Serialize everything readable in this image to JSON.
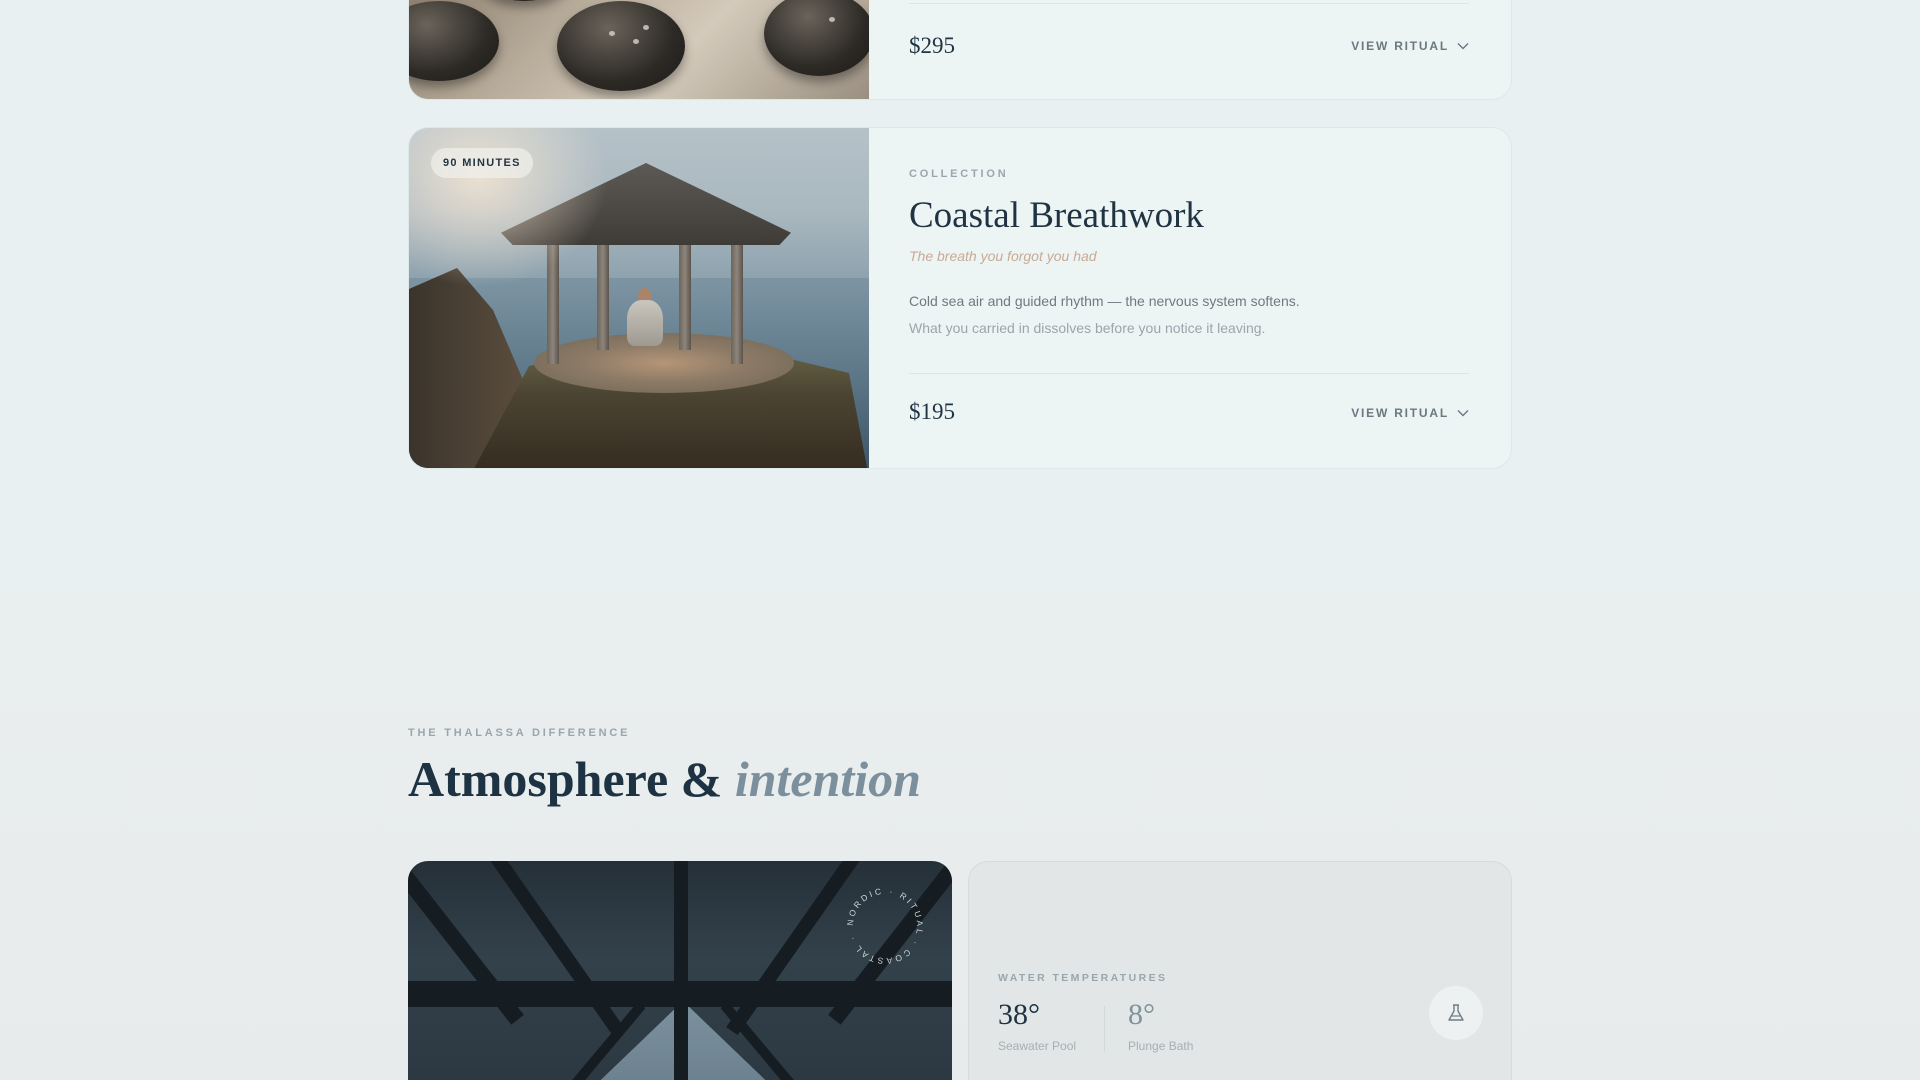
{
  "rituals": [
    {
      "price": "$295",
      "view_label": "VIEW RITUAL"
    },
    {
      "duration": "90 MINUTES",
      "eyebrow": "COLLECTION",
      "title": "Coastal Breathwork",
      "tagline": "The breath you forgot you had",
      "description_line1": "Cold sea air and guided rhythm — the nervous system softens.",
      "description_line2": "What you carried in dissolves before you notice it leaving.",
      "price": "$195",
      "view_label": "VIEW RITUAL"
    }
  ],
  "difference": {
    "eyebrow": "THE THALASSA DIFFERENCE",
    "title_plain": "Atmosphere &",
    "title_emphasis": "intention",
    "badge_text": "NORDIC · RITUAL · COASTAL ·",
    "water": {
      "eyebrow": "WATER TEMPERATURES",
      "items": [
        {
          "value": "38°",
          "label": "Seawater Pool"
        },
        {
          "value": "8°",
          "label": "Plunge Bath"
        }
      ],
      "icon": "flask-icon"
    }
  },
  "colors": {
    "heading": "#1f3343",
    "tagline": "#c8aa94",
    "muted": "#9aa6ad"
  }
}
